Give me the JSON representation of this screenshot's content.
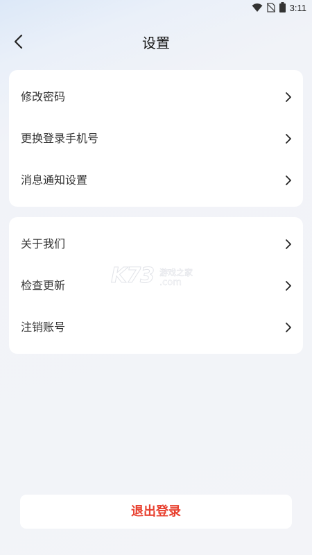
{
  "status_bar": {
    "time": "3:11",
    "icons": [
      "wifi-icon",
      "no-sim-icon",
      "battery-icon"
    ]
  },
  "header": {
    "title": "设置",
    "back_icon": "chevron-left-icon"
  },
  "groups": [
    {
      "items": [
        {
          "label": "修改密码",
          "icon": "chevron-right-icon"
        },
        {
          "label": "更换登录手机号",
          "icon": "chevron-right-icon"
        },
        {
          "label": "消息通知设置",
          "icon": "chevron-right-icon"
        }
      ]
    },
    {
      "items": [
        {
          "label": "关于我们",
          "icon": "chevron-right-icon"
        },
        {
          "label": "检查更新",
          "icon": "chevron-right-icon"
        },
        {
          "label": "注销账号",
          "icon": "chevron-right-icon"
        }
      ]
    }
  ],
  "watermark": {
    "brand": "K73",
    "line1": "游戏之家",
    "line2": ".com"
  },
  "logout": {
    "label": "退出登录"
  },
  "colors": {
    "accent_red": "#e8402f",
    "card_bg": "#ffffff",
    "page_bg": "#f3f4f8"
  }
}
